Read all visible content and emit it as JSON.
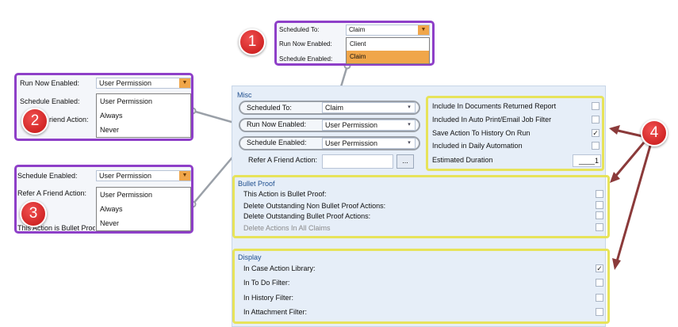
{
  "callouts": {
    "c1": "1",
    "c2": "2",
    "c3": "3",
    "c4": "4"
  },
  "top_popup": {
    "scheduled_to_label": "Scheduled To:",
    "scheduled_to_value": "Claim",
    "run_now_label": "Run Now Enabled:",
    "schedule_enabled_label": "Schedule Enabled:",
    "options": [
      "Client",
      "Claim"
    ],
    "selected_option": "Claim"
  },
  "left_popup_1": {
    "run_now_label": "Run Now Enabled:",
    "run_now_value": "User Permission",
    "schedule_label": "Schedule Enabled:",
    "friend_label": "riend Action:",
    "options": [
      "User Permission",
      "Always",
      "Never"
    ]
  },
  "left_popup_2": {
    "schedule_label": "Schedule Enabled:",
    "schedule_value": "User Permission",
    "friend_label": "Refer A Friend Action:",
    "bullet_label": "This Action is Bullet Proo",
    "options": [
      "User Permission",
      "Always",
      "Never"
    ]
  },
  "misc": {
    "title": "Misc",
    "scheduled_to_label": "Scheduled To:",
    "scheduled_to_value": "Claim",
    "run_now_label": "Run Now Enabled:",
    "run_now_value": "User Permission",
    "schedule_label": "Schedule Enabled:",
    "schedule_value": "User Permission",
    "refer_label": "Refer A Friend Action:",
    "browse_label": "..."
  },
  "report_options": {
    "items": [
      {
        "label": "Include In Documents Returned Report",
        "checked": false
      },
      {
        "label": "Included In Auto Print/Email Job Filter",
        "checked": false
      },
      {
        "label": "Save Action To History On Run",
        "checked": true
      },
      {
        "label": "Included in Daily Automation",
        "checked": false
      }
    ],
    "duration_label": "Estimated Duration",
    "duration_value": "____1"
  },
  "bullet_proof": {
    "title": "Bullet Proof",
    "items": [
      {
        "label": "This Action is Bullet Proof:",
        "checked": false,
        "disabled": false
      },
      {
        "label": "Delete Outstanding Non Bullet Proof Actions:",
        "checked": false,
        "disabled": false
      },
      {
        "label": "Delete Outstanding Bullet Proof Actions:",
        "checked": false,
        "disabled": false
      },
      {
        "label": "Delete Actions In All Claims",
        "checked": false,
        "disabled": true
      }
    ]
  },
  "display": {
    "title": "Display",
    "items": [
      {
        "label": "In Case Action Library:",
        "checked": true
      },
      {
        "label": "In To Do Filter:",
        "checked": false
      },
      {
        "label": "In History Filter:",
        "checked": false
      },
      {
        "label": "In Attachment Filter:",
        "checked": false
      }
    ]
  },
  "glyphs": {
    "check": "✓",
    "arrow": "▾",
    "orange_arrow": "▼"
  },
  "colors": {
    "callout_red": "#d21e1e",
    "highlight_purple": "#8e3fc8",
    "highlight_yellow": "#e7e35a",
    "arrow_brown": "#8b3a3a",
    "dropdown_selected": "#f0a64a"
  }
}
